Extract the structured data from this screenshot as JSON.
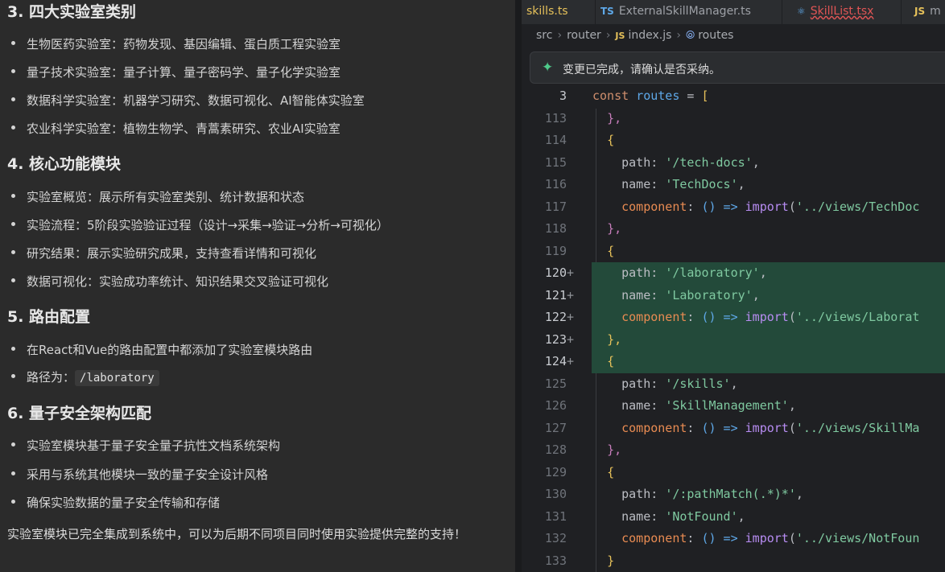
{
  "chat": {
    "sections": [
      {
        "title": "3. 四大实验室类别",
        "items": [
          "生物医药实验室：药物发现、基因编辑、蛋白质工程实验室",
          "量子技术实验室：量子计算、量子密码学、量子化学实验室",
          "数据科学实验室：机器学习研究、数据可视化、AI智能体实验室",
          "农业科学实验室：植物生物学、青蒿素研究、农业AI实验室"
        ]
      },
      {
        "title": "4. 核心功能模块",
        "items": [
          "实验室概览：展示所有实验室类别、统计数据和状态",
          "实验流程：5阶段实验验证过程（设计→采集→验证→分析→可视化）",
          "研究结果：展示实验研究成果，支持查看详情和可视化",
          "数据可视化：实验成功率统计、知识结果交叉验证可视化"
        ]
      },
      {
        "title": "5. 路由配置",
        "items": [
          "在React和Vue的路由配置中都添加了实验室模块路由"
        ],
        "route_label": "路径为：",
        "route_code": "/laboratory"
      },
      {
        "title": "6. 量子安全架构匹配",
        "items": [
          "实验室模块基于量子安全量子抗性文档系统架构",
          "采用与系统其他模块一致的量子安全设计风格",
          "确保实验数据的量子安全传输和存储"
        ]
      }
    ],
    "closing": "实验室模块已完全集成到系统中，可以为后期不同项目同时使用实验提供完整的支持！"
  },
  "editor": {
    "tabs": [
      {
        "lang": "",
        "name": "skills.ts"
      },
      {
        "lang": "TS",
        "name": "ExternalSkillManager.ts"
      },
      {
        "lang": "⚛",
        "name": "SkillList.tsx"
      },
      {
        "lang": "JS",
        "name": "m"
      }
    ],
    "breadcrumb": {
      "a": "src",
      "b": "router",
      "c_lang": "JS",
      "c": "index.js",
      "d": "routes"
    },
    "notice": "变更已完成，请确认是否采纳。",
    "lines": [
      {
        "n": "3"
      },
      {
        "n": "113"
      },
      {
        "n": "114"
      },
      {
        "n": "115"
      },
      {
        "n": "116"
      },
      {
        "n": "117"
      },
      {
        "n": "118"
      },
      {
        "n": "119"
      },
      {
        "n": "120"
      },
      {
        "n": "121"
      },
      {
        "n": "122"
      },
      {
        "n": "123"
      },
      {
        "n": "124"
      },
      {
        "n": "125"
      },
      {
        "n": "126"
      },
      {
        "n": "127"
      },
      {
        "n": "128"
      },
      {
        "n": "129"
      },
      {
        "n": "130"
      },
      {
        "n": "131"
      },
      {
        "n": "132"
      },
      {
        "n": "133"
      }
    ],
    "code": {
      "l3_const": "const",
      "l3_routes": "routes",
      "l3_eq": " = ",
      "l3_br": "[",
      "close_obj": "},",
      "open_obj": "{",
      "path_key": "path",
      "name_key": "name",
      "component_key": "component",
      "arrow": "() =>",
      "import_kw": "import",
      "p_techdocs": "'/tech-docs'",
      "n_techdocs": "'TechDocs'",
      "c_techdocs": "'../views/TechDoc",
      "p_lab": "'/laboratory'",
      "n_lab": "'Laboratory'",
      "c_lab": "'../views/Laborat",
      "p_skills": "'/skills'",
      "n_skills": "'SkillManagement'",
      "c_skills": "'../views/SkillMa",
      "p_notfound": "'/:pathMatch(.*)*'",
      "n_notfound": "'NotFound'",
      "c_notfound": "'../views/NotFoun",
      "close_last": "}"
    }
  }
}
